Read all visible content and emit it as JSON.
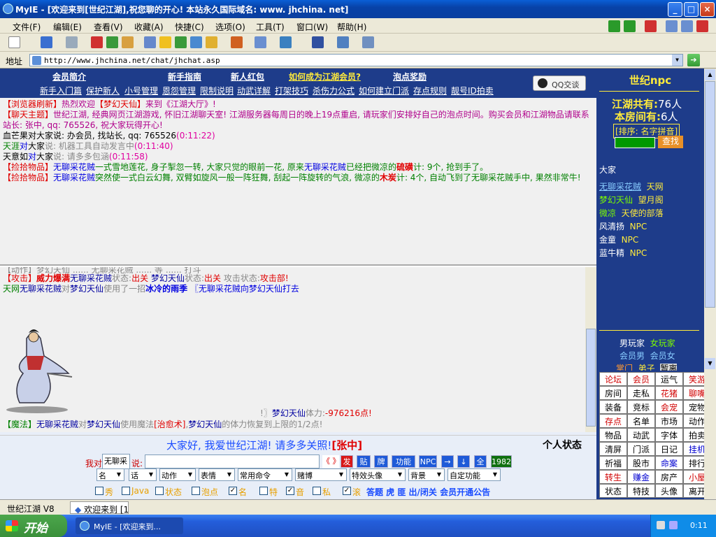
{
  "window": {
    "title": "MyIE - [欢迎来到[世纪江湖],祝您聊的开心! 本站永久国际域名: www. jhchina. net]"
  },
  "menu": [
    "文件(F)",
    "编辑(E)",
    "查看(V)",
    "收藏(A)",
    "快捷(C)",
    "选项(O)",
    "工具(T)",
    "窗口(W)",
    "帮助(H)"
  ],
  "address": {
    "label": "地址",
    "url": "http://www.jhchina.net/chat/jhchat.asp"
  },
  "topnav": {
    "row1": [
      "会员简介",
      "新手指南",
      "新人红包",
      "如何成为江湖会员?",
      "泡点奖励"
    ],
    "row2": [
      "新手入门篇",
      "保护新人",
      "小号管理",
      "恩怨管理",
      "限制说明",
      "动武详解",
      "打架技巧",
      "杀伤力公式",
      "如何建立门派",
      "存点规则",
      "靓号ID拍卖"
    ],
    "qq": "QQ交谈"
  },
  "chat1": {
    "l1a": "【浏览器刷新】",
    "l1b": "热烈欢迎",
    "l1c": "【梦幻天仙】",
    "l1d": "来到《江湖大厅》!",
    "l2a": "【聊天主题】",
    "l2b": "世纪江湖, 经典网页江湖游戏, 怀旧江湖聊天室! 江湖服务器每周日的晚上19点重启, 请玩家们安排好自己的泡点时间。购买会员和江湖物品请联系站长: 张中, qq: 765526, 祝大家玩得开心!",
    "l3a": "血芒果对大家说: 办会员, 找站长, qq: 765526",
    "l3b": "(0:11:22)",
    "l4a": "天涯",
    "l4b": "对",
    "l4c": "大家",
    "l4d": "说: 机器工具自动发言中",
    "l4e": "(0:11:40)",
    "l5a": "天意如",
    "l5b": "对",
    "l5c": "大家",
    "l5d": "说: 请多多包涵",
    "l5e": "(0:11:58)",
    "l6a": "【捡拾物品】",
    "l6b": "无聊采花贼",
    "l6c": "一式雪地莲花, 身子掣忽一转, 大家只觉的眼前一花, 原来",
    "l6d": "无聊采花贼",
    "l6e": "已经把微凉的",
    "l6f": "硫磺",
    "l6g": "计: 9个, 抢到手了。",
    "l7a": "【捡拾物品】",
    "l7b": "无聊采花贼",
    "l7c": "突然使一式白云幻舞, 双臂如旋风一般一阵狂舞, 刮起一阵旋转的气浪, 微凉的",
    "l7d": "木炭",
    "l7e": "计: 4个, 自动飞到了无聊采花贼手中, 果然非常牛!"
  },
  "chat2": {
    "l1": "【动作】梦幻天仙 ...... 无聊采花贼 ...... 等 ...... 打斗",
    "l2a": "【攻击】",
    "l2b": "威力爆满",
    "l2c": "无聊采花贼",
    "l2d": "状态:",
    "l2e": "出关",
    "l2f": "梦幻天仙",
    "l2g": "状态:",
    "l2h": "出关",
    "l2i": "攻击状态:",
    "l2j": "攻击部!",
    "l3a": "天网",
    "l3b": "无聊采花贼",
    "l3c": "对",
    "l3d": "梦幻天仙",
    "l3e": "使用了一招",
    "l3f": "冰冷的雨季",
    "l3g": "〖无聊采花贼向梦幻天仙打去",
    "l4a": "!〗",
    "l4b": "梦幻天仙",
    "l4c": "体力:",
    "l4d": "-976216点!",
    "l5a": "【魔法】",
    "l5b": "无聊采花贼",
    "l5c": "对",
    "l5d": "梦幻天仙",
    "l5e": "使用魔法",
    "l5f": "[治愈术]",
    "l5g": ",",
    "l5h": "梦幻天仙",
    "l5i": "的体力恢复到上限的1/2点!"
  },
  "bottom": {
    "announce": "大家好, 我爱世纪江湖! 请多多关照!",
    "announce_name": "[张中]",
    "status_title": "个人状态",
    "i_to": "我对",
    "to_value": "无聊采",
    "say": "说:",
    "btns": [
      "《 》",
      "发",
      "贴",
      "牌",
      "功能",
      "NPC",
      "→",
      "↓",
      "全",
      "1982"
    ],
    "selects": [
      "名",
      "话",
      "动作",
      "表情",
      "常用命令",
      "赌博",
      "特效头像",
      "背景",
      "自定功能"
    ],
    "checks": [
      "秀",
      "Java",
      "状态",
      "泡点",
      "名",
      "特",
      "音",
      "私",
      "滚"
    ],
    "checked": [
      false,
      false,
      false,
      false,
      true,
      false,
      true,
      false,
      true
    ],
    "extra": "答题  虎  匪  出/闭关  会员开通公告"
  },
  "right": {
    "header": "世纪npc",
    "total_label": "江湖共有:",
    "total": "76人",
    "room_label": "本房间有:",
    "room": "6人",
    "sort": "[排序: 名字拼音]",
    "find": "查找",
    "everyone": "大家",
    "users": [
      {
        "name": "无聊采花贼",
        "tag": "天网"
      },
      {
        "name": "梦幻天仙",
        "tag": "望月阁"
      },
      {
        "name": "微凉",
        "tag": "天使的部落"
      },
      {
        "name": "风清扬",
        "tag": "NPC"
      },
      {
        "name": "金童",
        "tag": "NPC"
      },
      {
        "name": "蓝牛精",
        "tag": "NPC"
      }
    ],
    "legend1a": "男玩家",
    "legend1b": "女玩家",
    "legend2a": "会员男",
    "legend2b": "会员女",
    "legend3a": "掌门",
    "legend3b": "弟子",
    "legend3c": "暂离",
    "grid": [
      "论坛",
      "会员",
      "运气",
      "笑游",
      "房间",
      "走私",
      "花猪",
      "聊嘴",
      "装备",
      "竞标",
      "会宠",
      "宠物",
      "存点",
      "名单",
      "市场",
      "动作",
      "物品",
      "动武",
      "字体",
      "拍卖",
      "清屏",
      "门派",
      "日记",
      "挂机",
      "祈福",
      "股市",
      "命案",
      "排行",
      "转生",
      "赚金",
      "房产",
      "小屋",
      "状态",
      "特技",
      "头像",
      "离开"
    ]
  },
  "tabs": [
    "世纪江湖  V8",
    "欢迎来到 [1"
  ],
  "taskbar": {
    "start": "开始",
    "task": "MyIE - [欢迎来到...",
    "clock": "0:11"
  }
}
